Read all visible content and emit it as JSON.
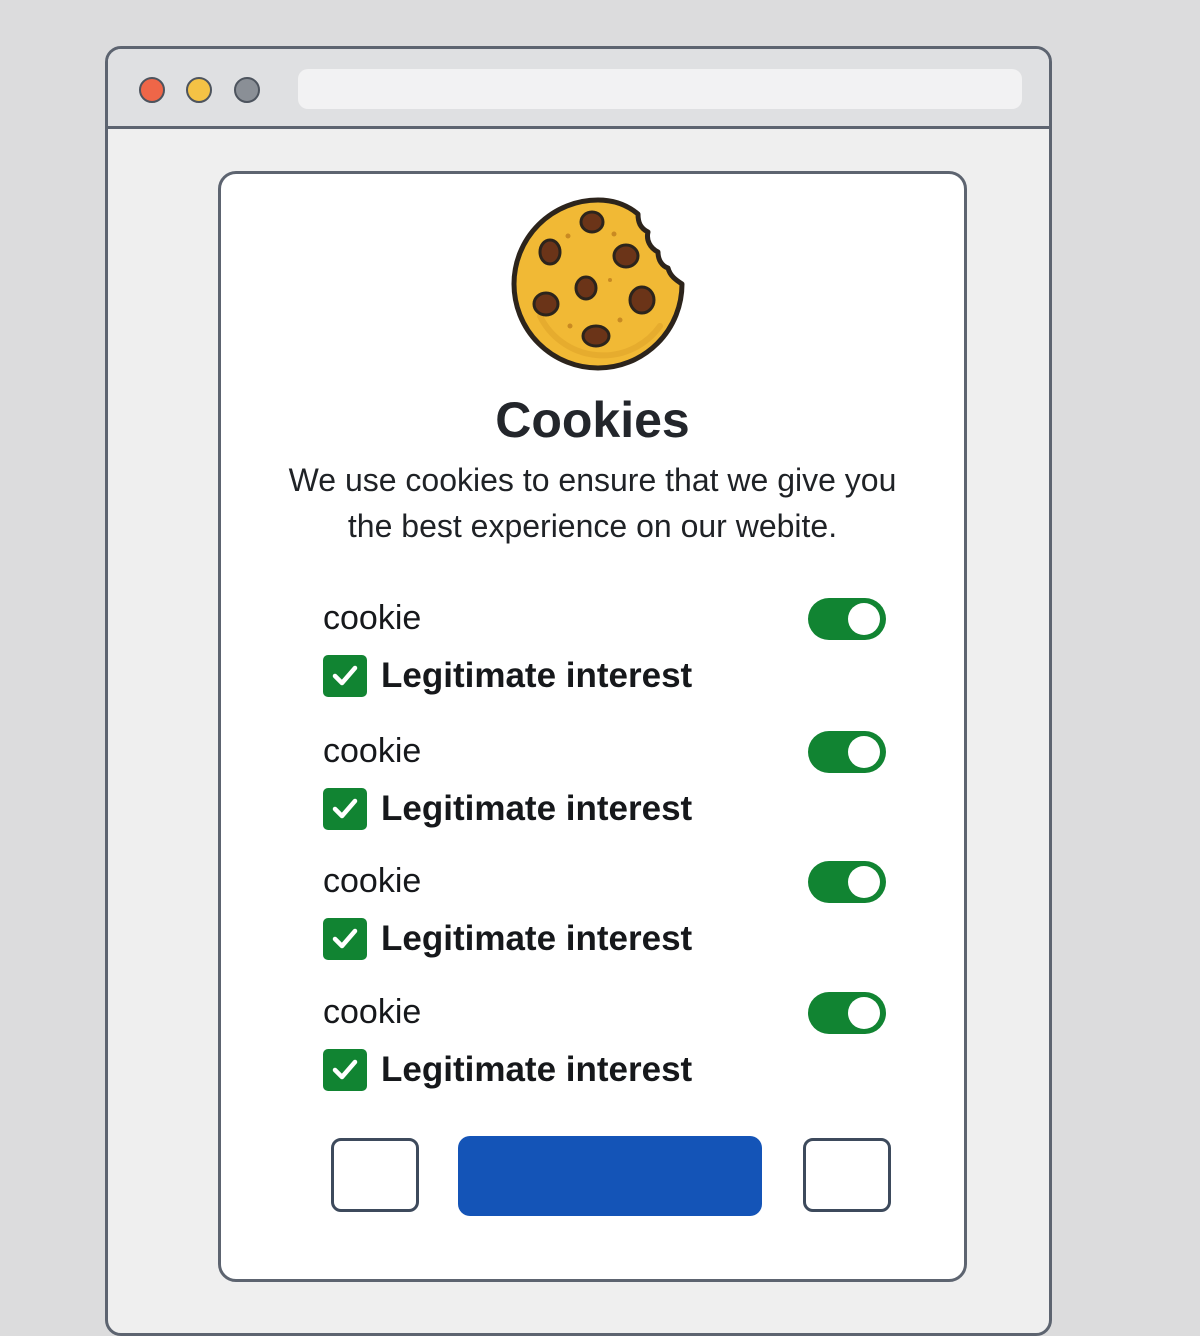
{
  "dialog": {
    "title": "Cookies",
    "description": "We use cookies to ensure that we give you the best experience on our webite."
  },
  "items": [
    {
      "label": "cookie",
      "toggle_on": true,
      "checkbox_label": "Legitimate interest",
      "checked": true
    },
    {
      "label": "cookie",
      "toggle_on": true,
      "checkbox_label": "Legitimate interest",
      "checked": true
    },
    {
      "label": "cookie",
      "toggle_on": true,
      "checkbox_label": "Legitimate interest",
      "checked": true
    },
    {
      "label": "cookie",
      "toggle_on": true,
      "checkbox_label": "Legitimate interest",
      "checked": true
    }
  ],
  "colors": {
    "accent_green": "#118432",
    "primary_blue": "#1454b7",
    "window_red": "#ef6648",
    "window_yellow": "#f4c245",
    "window_gray": "#8a8f96"
  },
  "icons": {
    "logo": "cookie-icon",
    "check": "checkmark-icon"
  }
}
